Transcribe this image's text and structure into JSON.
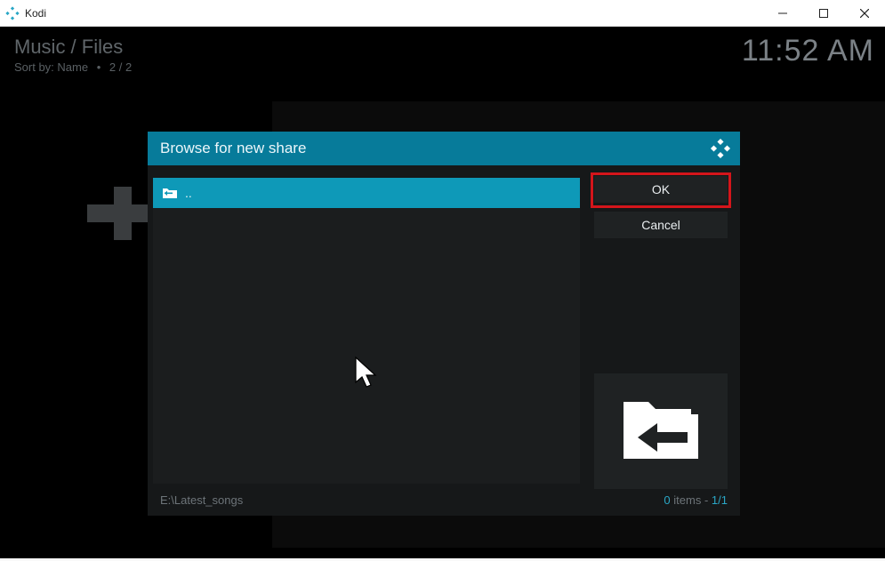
{
  "window": {
    "title": "Kodi"
  },
  "header": {
    "breadcrumb": "Music / Files",
    "sort_label": "Sort by:",
    "sort_value": "Name",
    "page": "2 / 2",
    "clock": "11:52 AM"
  },
  "dialog": {
    "title": "Browse for new share",
    "list": {
      "items": [
        {
          "label": ".."
        }
      ]
    },
    "buttons": {
      "ok": "OK",
      "cancel": "Cancel"
    },
    "path": "E:\\Latest_songs",
    "status": {
      "count": 0,
      "items_word": "items",
      "position": "1/1"
    }
  }
}
